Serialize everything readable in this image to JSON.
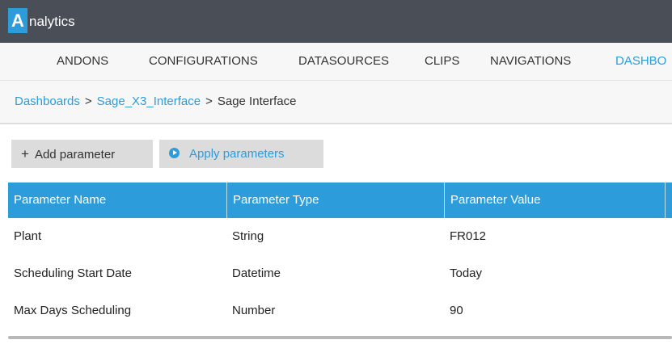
{
  "app": {
    "logo_letter": "A",
    "name_rest": "nalytics"
  },
  "nav": {
    "items": [
      {
        "label": "ANDONS"
      },
      {
        "label": "CONFIGURATIONS"
      },
      {
        "label": "DATASOURCES"
      },
      {
        "label": "CLIPS"
      },
      {
        "label": "NAVIGATIONS"
      },
      {
        "label": "DASHBO"
      }
    ],
    "active_index": 5
  },
  "breadcrumb": {
    "items": [
      "Dashboards",
      "Sage_X3_Interface"
    ],
    "separator": ">",
    "current": "Sage Interface"
  },
  "toolbar": {
    "add_label": "Add parameter",
    "apply_label": "Apply parameters"
  },
  "table": {
    "headers": [
      "Parameter Name",
      "Parameter Type",
      "Parameter Value"
    ],
    "rows": [
      [
        "Plant",
        "String",
        "FR012"
      ],
      [
        "Scheduling Start Date",
        "Datetime",
        "Today"
      ],
      [
        "Max Days Scheduling",
        "Number",
        "90"
      ]
    ]
  },
  "colors": {
    "accent": "#2d9cdb",
    "titlebar": "#4a4f57",
    "toolbar_button": "#dcdcdc"
  }
}
